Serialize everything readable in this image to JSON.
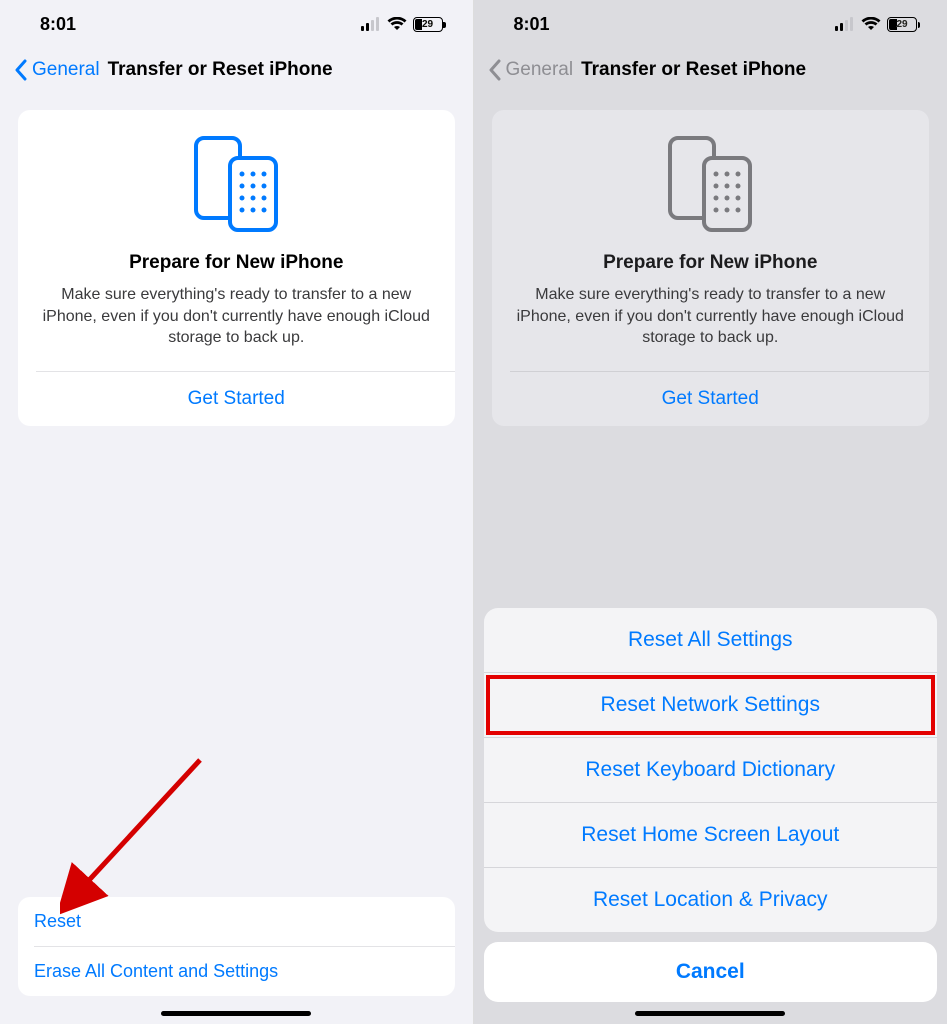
{
  "status": {
    "time": "8:01",
    "battery_pct": "29"
  },
  "nav": {
    "back": "General",
    "title": "Transfer or Reset iPhone"
  },
  "prepare": {
    "title": "Prepare for New iPhone",
    "desc": "Make sure everything's ready to transfer to a new iPhone, even if you don't currently have enough iCloud storage to back up.",
    "cta": "Get Started"
  },
  "bottom_options": {
    "reset": "Reset",
    "erase": "Erase All Content and Settings"
  },
  "sheet": {
    "items": [
      "Reset All Settings",
      "Reset Network Settings",
      "Reset Keyboard Dictionary",
      "Reset Home Screen Layout",
      "Reset Location & Privacy"
    ],
    "highlight_index": 1,
    "cancel": "Cancel"
  }
}
